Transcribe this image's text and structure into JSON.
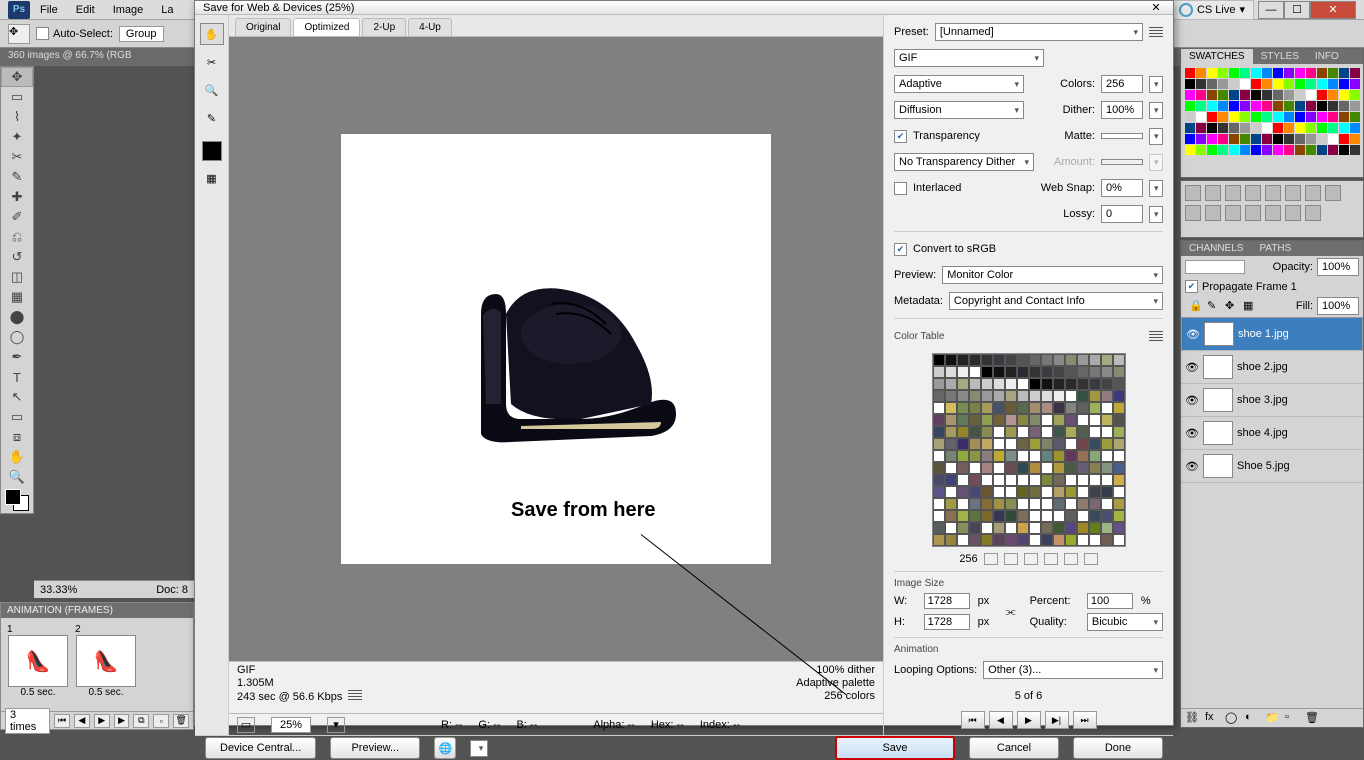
{
  "app": {
    "logo": "Ps",
    "menus": [
      "File",
      "Edit",
      "Image",
      "La"
    ],
    "cslive": "CS Live"
  },
  "optbar": {
    "autoselect": "Auto-Select:",
    "autoselect_val": "Group"
  },
  "doctab": "360 images @ 66.7% (RGB",
  "docfoot": {
    "zoom": "33.33%",
    "doc": "Doc: 8"
  },
  "anim": {
    "title": "ANIMATION (FRAMES)",
    "frames": [
      {
        "n": "1",
        "d": "0.5 sec."
      },
      {
        "n": "2",
        "d": "0.5 sec."
      }
    ],
    "loop": "3 times"
  },
  "right": {
    "tabs1": [
      "SWATCHES",
      "STYLES",
      "INFO"
    ],
    "tabs2": [
      "CHANNELS",
      "PATHS"
    ],
    "opacity": "Opacity:",
    "opv": "100%",
    "prop": "Propagate Frame 1",
    "fill": "Fill:",
    "fillv": "100%",
    "layers": [
      "shoe 1.jpg",
      "shoe 2.jpg",
      "shoe 3.jpg",
      "shoe 4.jpg",
      "Shoe 5.jpg"
    ]
  },
  "dialog": {
    "title": "Save for Web & Devices (25%)",
    "tabs": [
      "Original",
      "Optimized",
      "2-Up",
      "4-Up"
    ],
    "annotation": "Save from here",
    "info": {
      "fmt": "GIF",
      "size": "1.305M",
      "time": "243 sec @ 56.6 Kbps",
      "dither": "100% dither",
      "palette": "Adaptive palette",
      "colors": "256 colors"
    },
    "status": {
      "zoom": "25%",
      "r": "R:",
      "g": "G:",
      "b": "B:",
      "alpha": "Alpha: --",
      "hex": "Hex: --",
      "index": "Index: --"
    },
    "preset": {
      "label": "Preset:",
      "val": "[Unnamed]"
    },
    "format": "GIF",
    "reduction": "Adaptive",
    "colors_l": "Colors:",
    "colors_v": "256",
    "dither_m": "Diffusion",
    "dither_l": "Dither:",
    "dither_v": "100%",
    "transparency": "Transparency",
    "matte_l": "Matte:",
    "transdither": "No Transparency Dither",
    "amount_l": "Amount:",
    "interlaced": "Interlaced",
    "websnap_l": "Web Snap:",
    "websnap_v": "0%",
    "lossy_l": "Lossy:",
    "lossy_v": "0",
    "srgb": "Convert to sRGB",
    "preview_l": "Preview:",
    "preview_v": "Monitor Color",
    "meta_l": "Metadata:",
    "meta_v": "Copyright and Contact Info",
    "ct_label": "Color Table",
    "ct_count": "256",
    "imgsize_l": "Image Size",
    "w_l": "W:",
    "w_v": "1728",
    "h_l": "H:",
    "h_v": "1728",
    "px": "px",
    "pct_l": "Percent:",
    "pct_v": "100",
    "pct_s": "%",
    "qual_l": "Quality:",
    "qual_v": "Bicubic",
    "anim_l": "Animation",
    "loop_l": "Looping Options:",
    "loop_v": "Other (3)...",
    "frame": "5 of 6",
    "buttons": {
      "dc": "Device Central...",
      "pv": "Preview...",
      "save": "Save",
      "cancel": "Cancel",
      "done": "Done"
    }
  }
}
